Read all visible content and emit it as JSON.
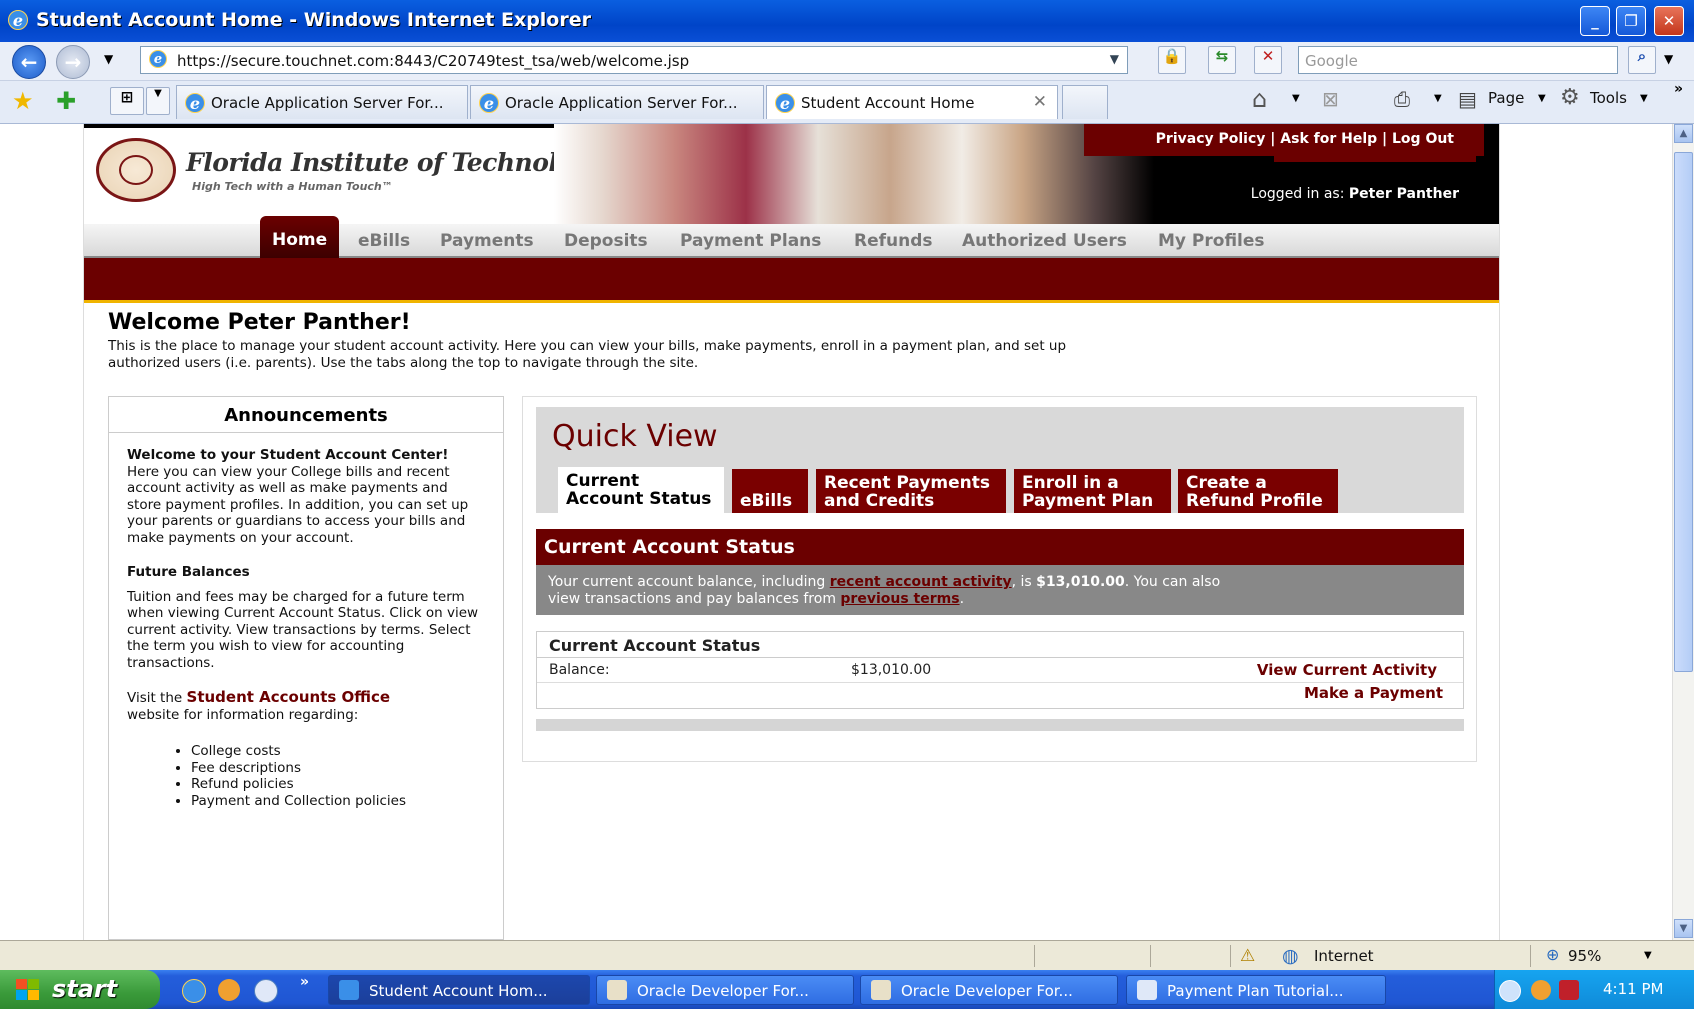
{
  "window": {
    "title": "Student Account Home - Windows Internet Explorer",
    "minimize": "_",
    "restore": "❐",
    "close": "✕"
  },
  "address": {
    "url": "https://secure.touchnet.com:8443/C20749test_tsa/web/welcome.jsp",
    "search_placeholder": "Google"
  },
  "tabs": [
    {
      "label": "Oracle Application Server For..."
    },
    {
      "label": "Oracle Application Server For..."
    },
    {
      "label": "Student Account Home"
    }
  ],
  "commands": {
    "page": "Page",
    "tools": "Tools"
  },
  "site": {
    "logo_name": "Florida Institute of Technology",
    "logo_tagline": "High Tech with a Human Touch™",
    "top_links": "Privacy Policy | Ask for Help | Log Out",
    "logged_in_label": "Logged in as:",
    "logged_in_user": "Peter Panther",
    "nav": [
      "Home",
      "eBills",
      "Payments",
      "Deposits",
      "Payment Plans",
      "Refunds",
      "Authorized Users",
      "My Profiles"
    ],
    "welcome": "Welcome Peter Panther!",
    "intro_line1": "This is the place to manage your student account activity. Here you can view your bills, make payments, enroll in a payment plan, and set up",
    "intro_line2": "authorized users (i.e. parents). Use the tabs along the top to navigate through the site."
  },
  "announcements": {
    "title": "Announcements",
    "p1_bold": "Welcome to your Student Account Center!",
    "p1_text": " Here you can view your College bills and recent account activity as well as make payments and store payment profiles. In addition, you can set up your parents or guardians to access your bills and make payments on your account.",
    "future_title": "Future Balances",
    "future_text": "Tuition and fees may be charged for a future term when viewing Current Account Status. Click on view current activity. View transactions by terms. Select the term you wish to view for accounting transactions.",
    "visit_prefix": "Visit the ",
    "visit_link": "Student Accounts Office",
    "visit_suffix": "website for information regarding:",
    "bullets": [
      "College costs",
      "Fee descriptions",
      "Refund policies",
      "Payment and Collection policies"
    ]
  },
  "quick_view": {
    "title": "Quick View",
    "tabs": [
      {
        "line1": "Current",
        "line2": "Account Status"
      },
      {
        "line1": "",
        "line2": "eBills"
      },
      {
        "line1": "Recent Payments",
        "line2": "and Credits"
      },
      {
        "line1": "Enroll in a",
        "line2": "Payment Plan"
      },
      {
        "line1": "Create a",
        "line2": "Refund Profile"
      }
    ],
    "section_title": "Current Account Status",
    "msg_prefix": "Your current account balance, including ",
    "msg_link1": "recent account activity",
    "msg_mid": ", is ",
    "msg_amount": "$13,010.00",
    "msg_after": ". You can also",
    "msg_line2": "view transactions and pay balances from ",
    "msg_link2": "previous terms",
    "msg_end": ".",
    "table_title": "Current Account Status",
    "balance_label": "Balance:",
    "balance_value": "$13,010.00",
    "view_activity": "View Current Activity",
    "make_payment": "Make a Payment"
  },
  "status": {
    "zone": "Internet",
    "zoom": "95%"
  },
  "taskbar": {
    "start": "start",
    "buttons": [
      {
        "label": "Student Account Hom..."
      },
      {
        "label": "Oracle Developer For..."
      },
      {
        "label": "Oracle Developer For..."
      },
      {
        "label": "Payment Plan Tutorial..."
      }
    ],
    "clock": "4:11 PM"
  }
}
